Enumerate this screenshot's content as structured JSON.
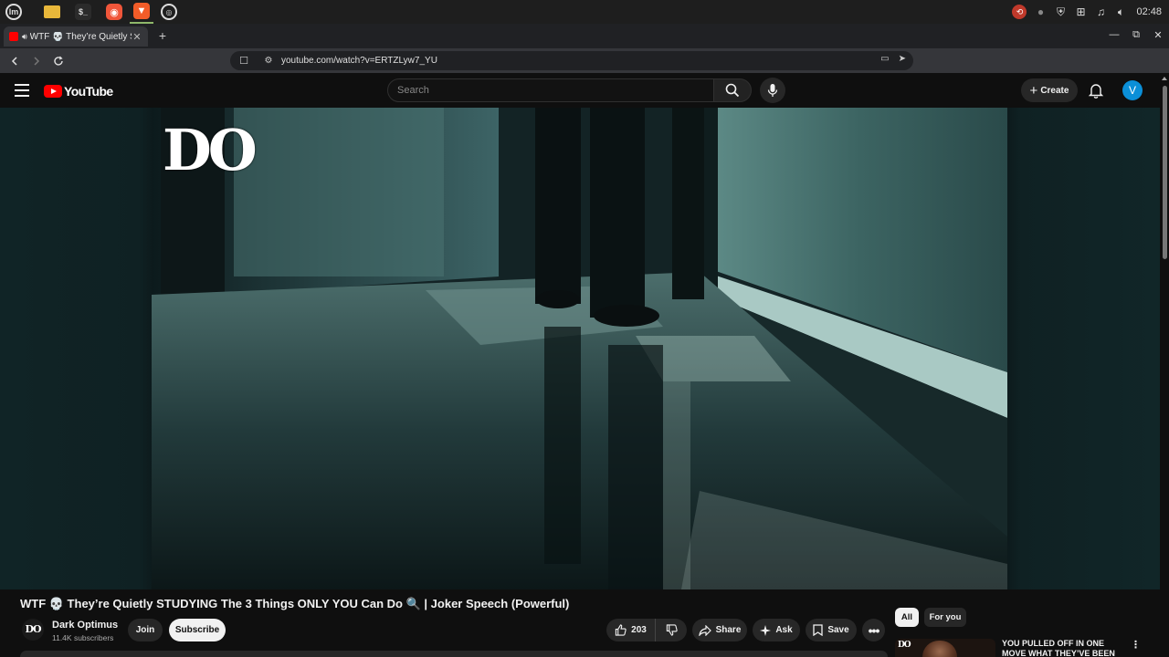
{
  "taskbar": {
    "apps": [
      "mint-menu-icon",
      "files-icon",
      "terminal-icon",
      "firefox-icon",
      "brave-icon",
      "chrome-icon"
    ],
    "clock": "02:48"
  },
  "browser": {
    "tab_title": "WTF 💀 They’re Quietly ST",
    "url": "youtube.com/watch?v=ERTZLyw7_YU"
  },
  "youtube": {
    "logo_text": "YouTube",
    "search_placeholder": "Search",
    "create_label": "Create",
    "avatar_letter": "V"
  },
  "player": {
    "watermark": "DO"
  },
  "video": {
    "title": "WTF 💀 They’re Quietly STUDYING The 3 Things ONLY YOU Can Do 🔍 | Joker Speech (Powerful)",
    "channel_avatar": "DO",
    "channel_name": "Dark Optimus",
    "subscribers": "11.4K subscribers",
    "join_label": "Join",
    "subscribe_label": "Subscribe",
    "likes": "203",
    "share_label": "Share",
    "ask_label": "Ask",
    "save_label": "Save"
  },
  "sidebar": {
    "chips": [
      "All",
      "For you"
    ],
    "rec_thumb_mark": "DO",
    "rec_title": "YOU PULLED OFF IN ONE MOVE WHAT THEY’VE BEEN FAILING"
  }
}
